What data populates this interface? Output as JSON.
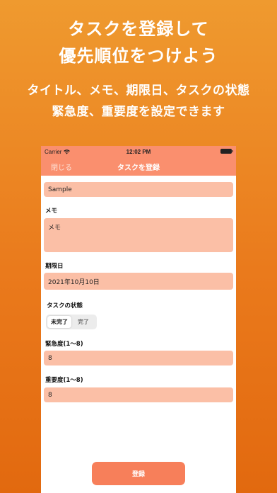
{
  "promo": {
    "headline_line1": "タスクを登録して",
    "headline_line2": "優先順位をつけよう",
    "sub_line1": "タイトル、メモ、期限日、タスクの状態",
    "sub_line2": "緊急度、重要度を設定できます"
  },
  "status_bar": {
    "carrier": "Carrier",
    "time": "12:02 PM",
    "icons": [
      "wifi-icon",
      "battery-icon"
    ]
  },
  "nav": {
    "close_label": "閉じる",
    "title": "タスクを登録"
  },
  "form": {
    "title_value": "Sample",
    "memo_label": "メモ",
    "memo_value": "メモ",
    "due_label": "期限日",
    "due_value": "2021年10月10日",
    "status_label": "タスクの状態",
    "status_options": [
      "未完了",
      "完了"
    ],
    "status_selected": "未完了",
    "urgency_label": "緊急度(1〜8)",
    "urgency_value": "8",
    "importance_label": "重要度(1〜8)",
    "importance_value": "8",
    "submit_label": "登録"
  },
  "colors": {
    "background_top": "#ef9a2f",
    "background_bottom": "#e2690f",
    "nav_bar": "#fa8f6e",
    "field_fill": "#fbbfa6",
    "submit_button": "#f77f5a"
  }
}
